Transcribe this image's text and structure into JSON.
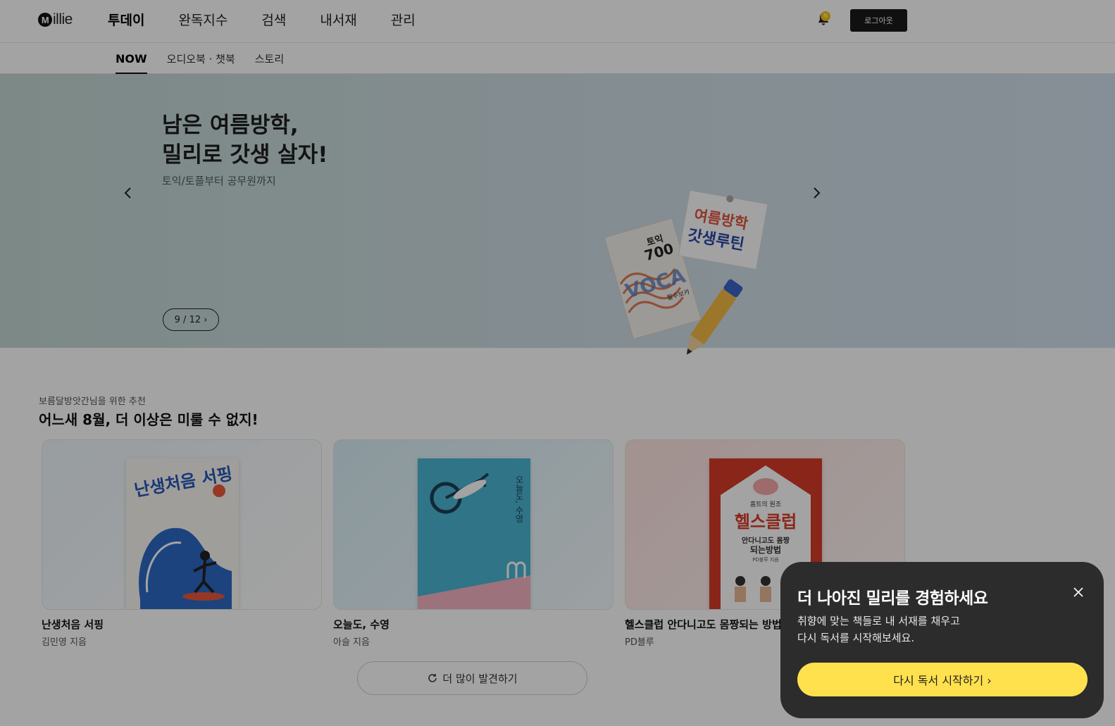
{
  "header": {
    "logo_text": "illie",
    "logo_mark": "M",
    "nav": [
      {
        "label": "투데이",
        "active": true
      },
      {
        "label": "완독지수"
      },
      {
        "label": "검색"
      },
      {
        "label": "내서재"
      },
      {
        "label": "관리"
      }
    ],
    "bell_icon": "bell-icon",
    "notification_count": "N",
    "logout_label": "로그아웃"
  },
  "subnav": {
    "tabs": [
      {
        "label": "NOW",
        "active": true
      },
      {
        "label": "오디오북 · 챗북"
      },
      {
        "label": "스토리"
      }
    ]
  },
  "hero": {
    "title": "남은 여름방학,\n밀리로 갓생 살자!",
    "subtitle": "토익/토플부터 공무원까지",
    "pager": "9 / 12",
    "pager_arrow": "›",
    "art": {
      "book_label": "토익",
      "book_number": "700",
      "book_word": "VOCA",
      "book_note": "필수보카",
      "note_line1": "여름방학",
      "note_line2": "갓생루틴"
    },
    "colors": {
      "bg_left": "#c3d7d3",
      "bg_right": "#d2e0ec"
    }
  },
  "recommend": {
    "kicker": "보름달방앗간님을 위한 추천",
    "title": "어느새 8월, 더 이상은 미룰 수 없지!",
    "cards": [
      {
        "title": "난생처음 서핑",
        "author": "김민영 지음",
        "cover_text": "난생처음 서핑"
      },
      {
        "title": "오늘도, 수영",
        "author": "아슬 지음",
        "cover_text": "오늘도, 수영"
      },
      {
        "title": "헬스클럽 안다니고도 몸짱되는 방법",
        "author": "PD블루",
        "cover_top": "홈트의 원조",
        "cover_text": "헬스클럽",
        "cover_sub1": "안다니고도 몸짱",
        "cover_sub2": "되는방법",
        "cover_author": "PD블루 지음"
      }
    ],
    "more_label": "더 많이 발견하기"
  },
  "popup": {
    "title": "더 나아진 밀리를 경험하세요",
    "body": "취향에 맞는 책들로 내 서재를 채우고\n다시 독서를 시작해보세요.",
    "cta": "다시 독서 시작하기 ›",
    "close_icon": "close-icon",
    "accent": "#ffe14d"
  }
}
